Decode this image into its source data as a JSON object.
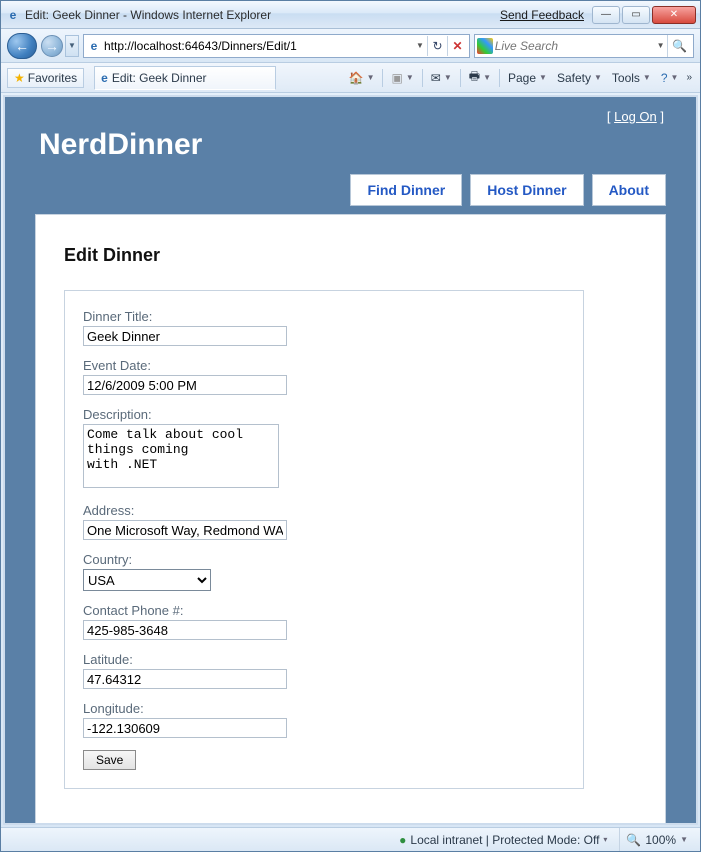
{
  "window": {
    "title": "Edit: Geek Dinner - Windows Internet Explorer",
    "feedback": "Send Feedback"
  },
  "nav": {
    "url": "http://localhost:64643/Dinners/Edit/1",
    "search_placeholder": "Live Search"
  },
  "toolbar": {
    "favorites": "Favorites",
    "tab_title": "Edit: Geek Dinner",
    "page": "Page",
    "safety": "Safety",
    "tools": "Tools"
  },
  "site": {
    "logon": "Log On",
    "brand": "NerdDinner",
    "menu": {
      "find": "Find Dinner",
      "host": "Host Dinner",
      "about": "About"
    }
  },
  "form": {
    "heading": "Edit Dinner",
    "labels": {
      "title": "Dinner Title:",
      "event_date": "Event Date:",
      "description": "Description:",
      "address": "Address:",
      "country": "Country:",
      "phone": "Contact Phone #:",
      "latitude": "Latitude:",
      "longitude": "Longitude:"
    },
    "values": {
      "title": "Geek Dinner",
      "event_date": "12/6/2009 5:00 PM",
      "description": "Come talk about cool things coming\nwith .NET",
      "address": "One Microsoft Way, Redmond WA",
      "country": "USA",
      "phone": "425-985-3648",
      "latitude": "47.64312",
      "longitude": "-122.130609"
    },
    "save": "Save"
  },
  "status": {
    "zone": "Local intranet | Protected Mode: Off",
    "zoom": "100%"
  }
}
